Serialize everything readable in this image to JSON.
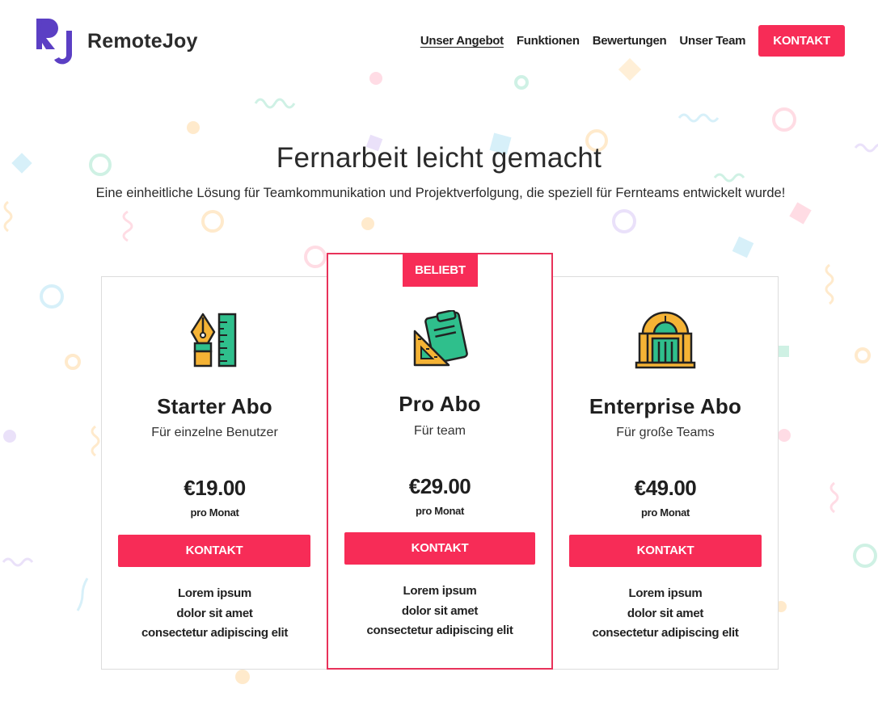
{
  "brand": {
    "logo_letters": "RJ",
    "name": "RemoteJoy",
    "colors": {
      "primary": "#f72c57",
      "logo": "#5b3fc4",
      "text": "#222222"
    }
  },
  "nav": {
    "links": [
      "Unser Angebot",
      "Funktionen",
      "Bewertungen",
      "Unser Team"
    ],
    "active": "Unser Angebot",
    "cta": "KONTAKT"
  },
  "hero": {
    "title": "Fernarbeit leicht gemacht",
    "subtitle": "Eine einheitliche Lösung für Teamkommunikation und Projektverfolgung, die speziell für Fernteams entwickelt wurde!"
  },
  "plans": [
    {
      "icon": "pen-and-ruler-icon",
      "name": "Starter Abo",
      "audience": "Für einzelne Benutzer",
      "price": "€19.00",
      "period": "pro Monat",
      "button": "KONTAKT",
      "features": [
        "Lorem ipsum",
        "dolor sit amet",
        "consectetur adipiscing elit"
      ]
    },
    {
      "icon": "clipboard-and-set-square-icon",
      "badge": "BELIEBT",
      "name": "Pro Abo",
      "audience": "Für team",
      "price": "€29.00",
      "period": "pro Monat",
      "button": "KONTAKT",
      "features": [
        "Lorem ipsum",
        "dolor sit amet",
        "consectetur adipiscing elit"
      ]
    },
    {
      "icon": "building-icon",
      "name": "Enterprise Abo",
      "audience": "Für große Teams",
      "price": "€49.00",
      "period": "pro Monat",
      "button": "KONTAKT",
      "features": [
        "Lorem ipsum",
        "dolor sit amet",
        "consectetur adipiscing elit"
      ]
    }
  ]
}
